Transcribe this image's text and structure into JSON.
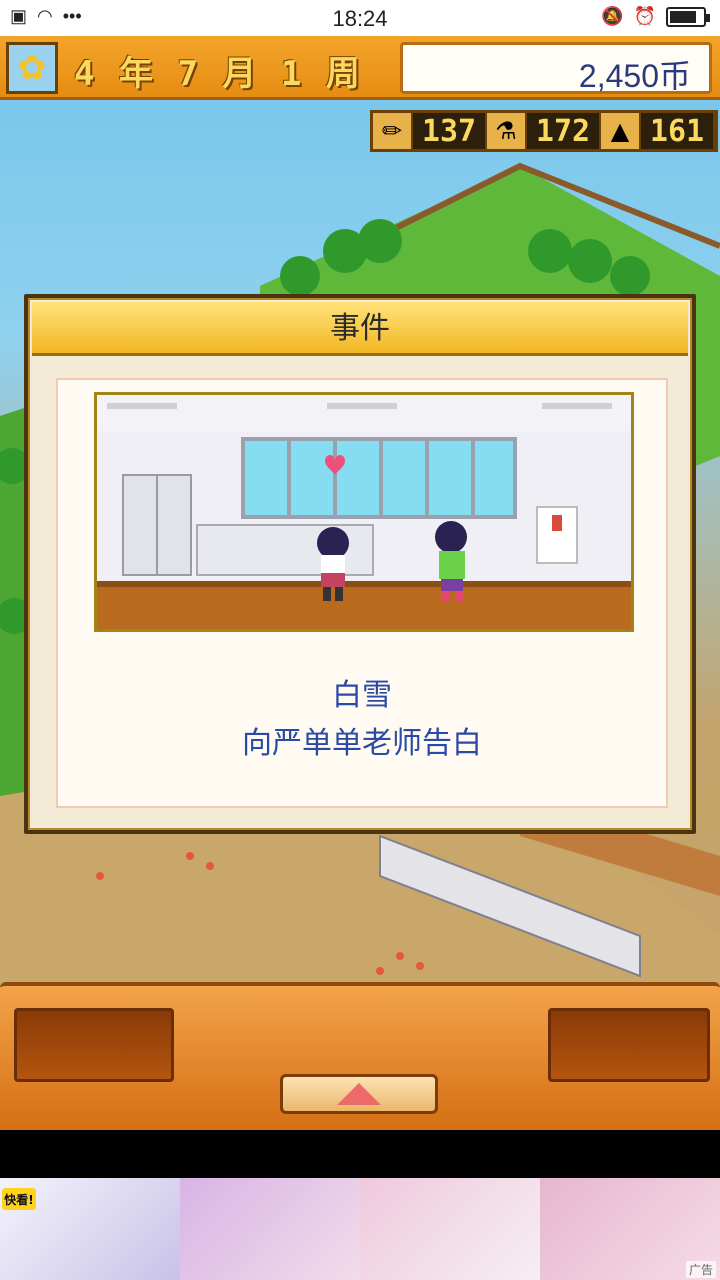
{
  "status_bar": {
    "time": "18:24",
    "left_icons": [
      "sim-icon",
      "wifi-icon",
      "more-icon"
    ],
    "right_icons": [
      "mute-icon",
      "alarm-icon",
      "battery-icon"
    ]
  },
  "header": {
    "year": "4",
    "year_unit": "年",
    "month": "7",
    "month_unit": "月",
    "week": "1",
    "week_unit": "周",
    "money": "2,450币"
  },
  "resources": [
    {
      "icon": "pencil-icon",
      "value": "137"
    },
    {
      "icon": "flask-icon",
      "value": "172"
    },
    {
      "icon": "cone-icon",
      "value": "161"
    }
  ],
  "event_dialog": {
    "title": "事件",
    "character_name": "白雪",
    "description": "向严单单老师告白"
  },
  "bottom_panel": {
    "up_button": "▲"
  },
  "ad": {
    "logo_text": "快看!",
    "label": "广告"
  },
  "colors": {
    "accent_orange": "#e68c12",
    "text_blue": "#2a4aa3",
    "digit_yellow": "#fbd95e"
  }
}
